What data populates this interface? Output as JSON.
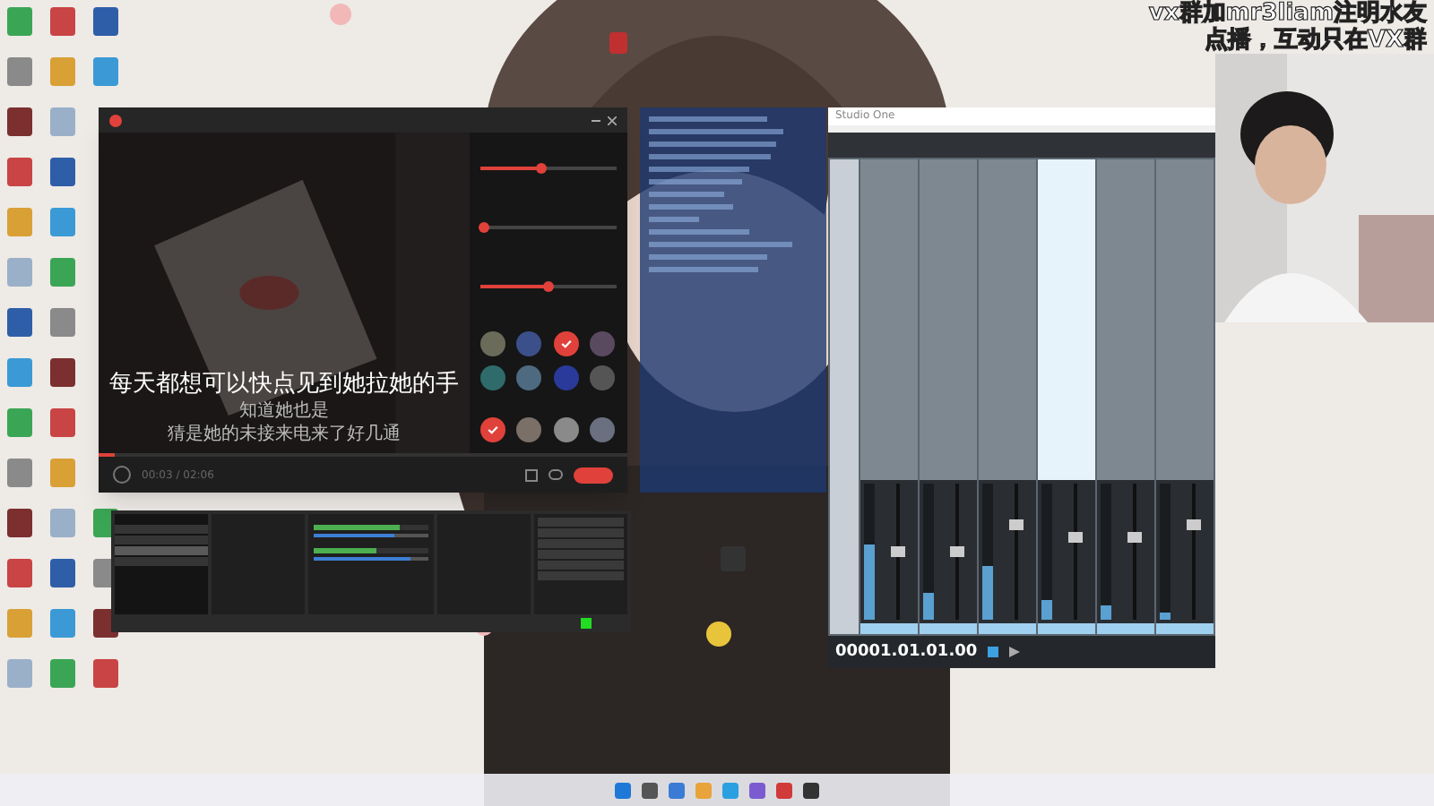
{
  "caption": [
    "vx群加mr3liam注明水友",
    "点播，互动只在VX群"
  ],
  "karaoke": {
    "sliders": [
      {
        "level": 0.45
      },
      {
        "level": 0.02
      },
      {
        "level": 0.5
      }
    ],
    "effects": [
      {
        "selected": false,
        "color": "#6b6b5a"
      },
      {
        "selected": false,
        "color": "#3b4f8a"
      },
      {
        "selected": true,
        "color": "#e0413a"
      },
      {
        "selected": false,
        "color": "#5a4a60"
      },
      {
        "selected": false,
        "color": "#2f6b6b"
      },
      {
        "selected": false,
        "color": "#4d6a80"
      },
      {
        "selected": false,
        "color": "#2a3a9a"
      },
      {
        "selected": false,
        "color": "#555555"
      }
    ],
    "voices": [
      {
        "selected": true,
        "color": "#e0413a"
      },
      {
        "selected": false,
        "color": "#7a7068"
      },
      {
        "selected": false,
        "color": "#8a8a8a"
      },
      {
        "selected": false,
        "color": "#6a7080"
      }
    ],
    "lyrics": [
      "每天都想可以快点见到她拉她的手",
      "知道她也是",
      "猜是她的未接来电来了好几通"
    ],
    "progress": {
      "level": 0.03
    },
    "time": "00:03 / 02:06"
  },
  "obs": {
    "scenes": [
      {
        "selected": false
      },
      {
        "selected": false
      },
      {
        "selected": true
      },
      {
        "selected": false
      }
    ],
    "meters": [
      {
        "level": 0.75,
        "slider": {
          "level": 0.7
        }
      },
      {
        "level": 0.55,
        "slider": {
          "level": 0.85
        }
      }
    ],
    "recording": true
  },
  "studio_one": {
    "title": "Studio One",
    "timecode": "00001.01.01.00",
    "channels": [
      {
        "level": 0.55,
        "fader": {
          "level": 0.5
        },
        "selected": false
      },
      {
        "level": 0.2,
        "fader": {
          "level": 0.5
        },
        "selected": false
      },
      {
        "level": 0.4,
        "fader": {
          "level": 0.7
        },
        "selected": false
      },
      {
        "level": 0.15,
        "fader": {
          "level": 0.6
        },
        "selected": true
      },
      {
        "level": 0.1,
        "fader": {
          "level": 0.6
        },
        "selected": false
      },
      {
        "level": 0.05,
        "fader": {
          "level": 0.7
        },
        "selected": false
      }
    ]
  }
}
